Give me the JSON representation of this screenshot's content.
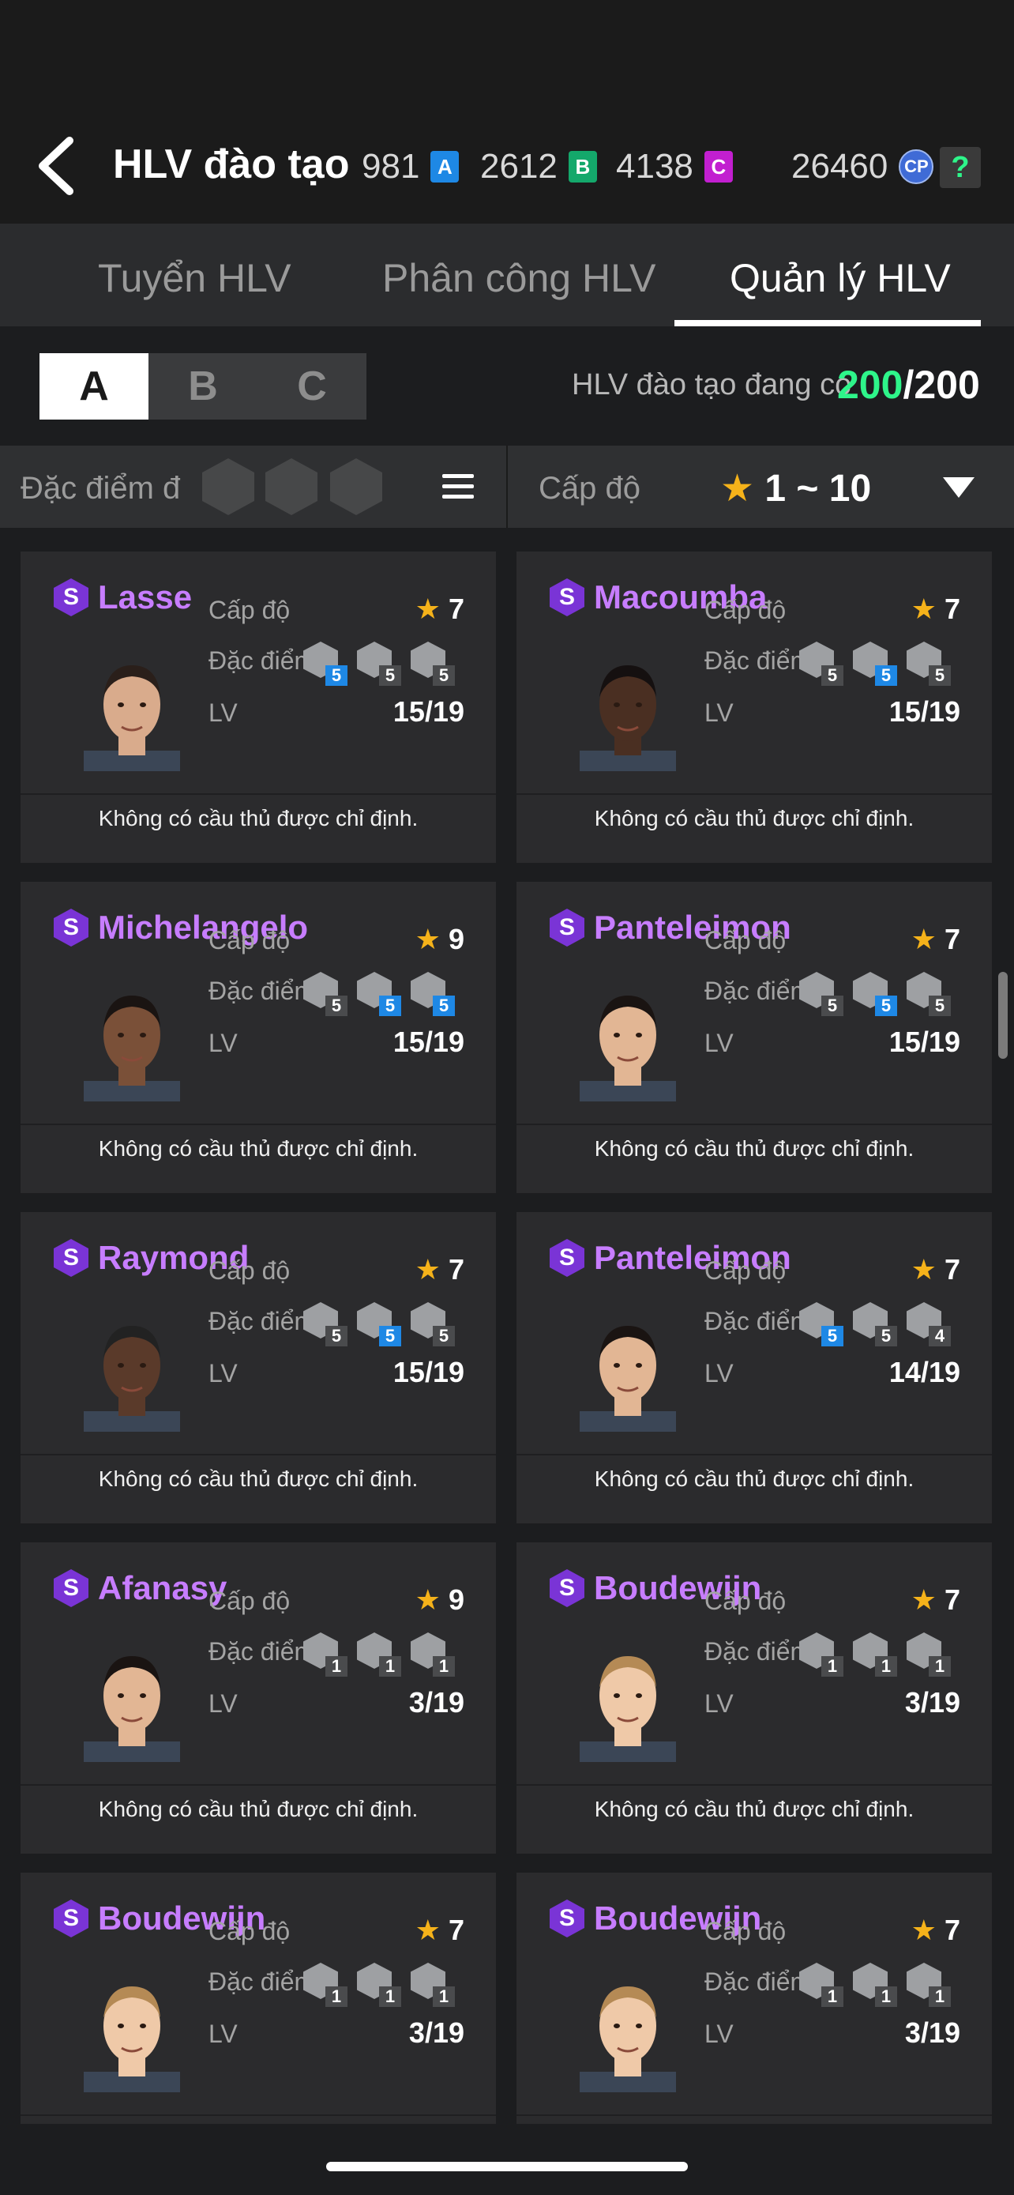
{
  "header": {
    "title": "HLV đào tạo",
    "currencies": [
      {
        "value": "981",
        "badge": "A",
        "color": "#1e88e5"
      },
      {
        "value": "2612",
        "badge": "B",
        "color": "#14a86b"
      },
      {
        "value": "4138",
        "badge": "C",
        "color": "#c21fd0"
      }
    ],
    "cp": {
      "value": "26460",
      "badge": "CP"
    },
    "help_label": "?"
  },
  "tabs": [
    {
      "label": "Tuyển HLV",
      "active": false
    },
    {
      "label": "Phân công HLV",
      "active": false
    },
    {
      "label": "Quản lý HLV",
      "active": true
    }
  ],
  "segments": [
    {
      "label": "A",
      "active": true
    },
    {
      "label": "B",
      "active": false
    },
    {
      "label": "C",
      "active": false
    }
  ],
  "coach_count": {
    "label": "HLV đào tạo đang có",
    "current": "200",
    "max": "/200"
  },
  "filter": {
    "trait_label": "Đặc điểm đ",
    "level_label": "Cấp độ",
    "level_star": "★",
    "level_range": "1 ~ 10"
  },
  "card_labels": {
    "level": "Cấp độ",
    "trait": "Đặc điểm",
    "lv": "LV",
    "empty_note": "Không có cầu thủ được chỉ định."
  },
  "coaches": [
    {
      "tier": "S",
      "name": "Lasse",
      "stars": "7",
      "lv": "15/19",
      "traits": [
        {
          "n": "5",
          "blue": true
        },
        {
          "n": "5",
          "blue": false
        },
        {
          "n": "5",
          "blue": false
        }
      ]
    },
    {
      "tier": "S",
      "name": "Macoumba",
      "stars": "7",
      "lv": "15/19",
      "traits": [
        {
          "n": "5",
          "blue": false
        },
        {
          "n": "5",
          "blue": true
        },
        {
          "n": "5",
          "blue": false
        }
      ]
    },
    {
      "tier": "S",
      "name": "Michelangelo",
      "stars": "9",
      "lv": "15/19",
      "traits": [
        {
          "n": "5",
          "blue": false
        },
        {
          "n": "5",
          "blue": true
        },
        {
          "n": "5",
          "blue": true
        }
      ]
    },
    {
      "tier": "S",
      "name": "Panteleimon",
      "stars": "7",
      "lv": "15/19",
      "traits": [
        {
          "n": "5",
          "blue": false
        },
        {
          "n": "5",
          "blue": true
        },
        {
          "n": "5",
          "blue": false
        }
      ]
    },
    {
      "tier": "S",
      "name": "Raymond",
      "stars": "7",
      "lv": "15/19",
      "traits": [
        {
          "n": "5",
          "blue": false
        },
        {
          "n": "5",
          "blue": true
        },
        {
          "n": "5",
          "blue": false
        }
      ]
    },
    {
      "tier": "S",
      "name": "Panteleimon",
      "stars": "7",
      "lv": "14/19",
      "traits": [
        {
          "n": "5",
          "blue": true
        },
        {
          "n": "5",
          "blue": false
        },
        {
          "n": "4",
          "blue": false
        }
      ]
    },
    {
      "tier": "S",
      "name": "Afanasy",
      "stars": "9",
      "lv": "3/19",
      "traits": [
        {
          "n": "1",
          "blue": false
        },
        {
          "n": "1",
          "blue": false
        },
        {
          "n": "1",
          "blue": false
        }
      ]
    },
    {
      "tier": "S",
      "name": "Boudewijn",
      "stars": "7",
      "lv": "3/19",
      "traits": [
        {
          "n": "1",
          "blue": false
        },
        {
          "n": "1",
          "blue": false
        },
        {
          "n": "1",
          "blue": false
        }
      ]
    },
    {
      "tier": "S",
      "name": "Boudewijn",
      "stars": "7",
      "lv": "3/19",
      "traits": [
        {
          "n": "1",
          "blue": false
        },
        {
          "n": "1",
          "blue": false
        },
        {
          "n": "1",
          "blue": false
        }
      ]
    },
    {
      "tier": "S",
      "name": "Boudewijn",
      "stars": "7",
      "lv": "3/19",
      "traits": [
        {
          "n": "1",
          "blue": false
        },
        {
          "n": "1",
          "blue": false
        },
        {
          "n": "1",
          "blue": false
        }
      ]
    }
  ]
}
